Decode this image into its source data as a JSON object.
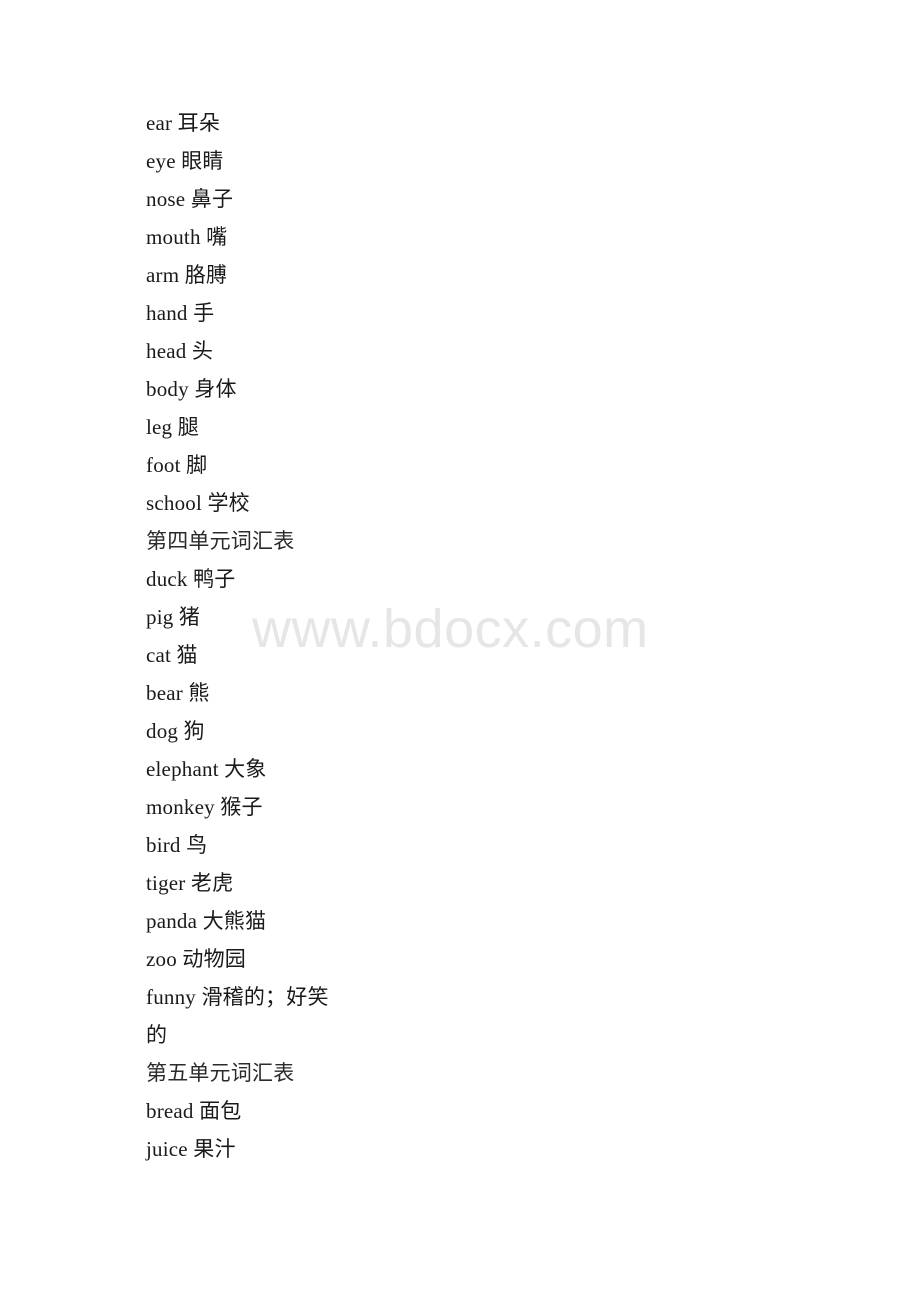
{
  "document": {
    "watermark": "www.bdocx.com",
    "lines": [
      {
        "text": "ear 耳朵",
        "type": "entry"
      },
      {
        "text": "eye 眼睛",
        "type": "entry"
      },
      {
        "text": "nose 鼻子",
        "type": "entry"
      },
      {
        "text": "mouth 嘴",
        "type": "entry"
      },
      {
        "text": "arm 胳膊",
        "type": "entry"
      },
      {
        "text": "hand 手",
        "type": "entry"
      },
      {
        "text": "head 头",
        "type": "entry"
      },
      {
        "text": "body 身体",
        "type": "entry"
      },
      {
        "text": "leg 腿",
        "type": "entry"
      },
      {
        "text": "foot 脚",
        "type": "entry"
      },
      {
        "text": "school 学校",
        "type": "entry"
      },
      {
        "text": "第四单元词汇表",
        "type": "section"
      },
      {
        "text": "duck 鸭子",
        "type": "entry"
      },
      {
        "text": "pig 猪",
        "type": "entry"
      },
      {
        "text": "cat 猫",
        "type": "entry"
      },
      {
        "text": "bear 熊",
        "type": "entry"
      },
      {
        "text": "dog 狗",
        "type": "entry"
      },
      {
        "text": "elephant 大象",
        "type": "entry"
      },
      {
        "text": "monkey 猴子",
        "type": "entry"
      },
      {
        "text": "bird 鸟",
        "type": "entry"
      },
      {
        "text": "tiger 老虎",
        "type": "entry"
      },
      {
        "text": "panda 大熊猫",
        "type": "entry"
      },
      {
        "text": "zoo 动物园",
        "type": "entry"
      },
      {
        "text": "funny 滑稽的；好笑",
        "type": "entry"
      },
      {
        "text": "的",
        "type": "entry-continuation"
      },
      {
        "text": "第五单元词汇表",
        "type": "section"
      },
      {
        "text": "bread 面包",
        "type": "entry"
      },
      {
        "text": "juice 果汁",
        "type": "entry"
      }
    ]
  }
}
